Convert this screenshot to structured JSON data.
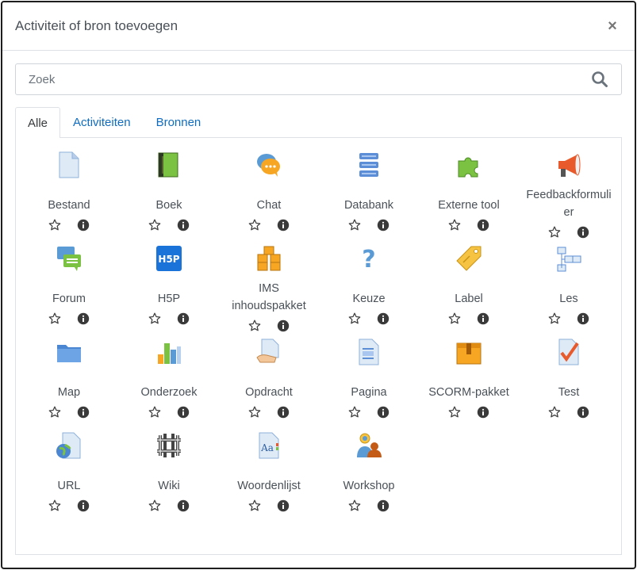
{
  "dialog": {
    "title": "Activiteit of bron toevoegen",
    "close_symbol": "×"
  },
  "search": {
    "placeholder": "Zoek",
    "value": ""
  },
  "tabs": [
    {
      "label": "Alle",
      "active": true
    },
    {
      "label": "Activiteiten",
      "active": false
    },
    {
      "label": "Bronnen",
      "active": false
    }
  ],
  "items": [
    {
      "label": "Bestand",
      "icon": "file-icon"
    },
    {
      "label": "Boek",
      "icon": "book-icon"
    },
    {
      "label": "Chat",
      "icon": "chat-icon"
    },
    {
      "label": "Databank",
      "icon": "database-icon"
    },
    {
      "label": "Externe tool",
      "icon": "puzzle-icon"
    },
    {
      "label": "Feedbackformulier",
      "icon": "megaphone-icon"
    },
    {
      "label": "Forum",
      "icon": "forum-icon"
    },
    {
      "label": "H5P",
      "icon": "h5p-icon"
    },
    {
      "label": "IMS inhoudspakket",
      "icon": "boxes-icon"
    },
    {
      "label": "Keuze",
      "icon": "question-icon"
    },
    {
      "label": "Label",
      "icon": "tag-icon"
    },
    {
      "label": "Les",
      "icon": "lesson-icon"
    },
    {
      "label": "Map",
      "icon": "folder-icon"
    },
    {
      "label": "Onderzoek",
      "icon": "bar-chart-icon"
    },
    {
      "label": "Opdracht",
      "icon": "assignment-icon"
    },
    {
      "label": "Pagina",
      "icon": "page-icon"
    },
    {
      "label": "SCORM-pakket",
      "icon": "scorm-box-icon"
    },
    {
      "label": "Test",
      "icon": "quiz-icon"
    },
    {
      "label": "URL",
      "icon": "url-globe-icon"
    },
    {
      "label": "Wiki",
      "icon": "wiki-icon"
    },
    {
      "label": "Woordenlijst",
      "icon": "glossary-icon"
    },
    {
      "label": "Workshop",
      "icon": "workshop-icon"
    }
  ],
  "colors": {
    "link": "#0f6cbf",
    "border": "#dee2e6",
    "text": "#495057"
  }
}
